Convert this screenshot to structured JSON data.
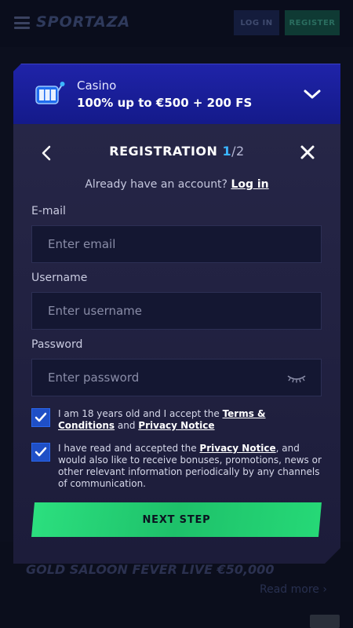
{
  "header": {
    "logo_text": "SPORTAZA",
    "login_label": "LOG IN",
    "register_label": "REGISTER"
  },
  "background": {
    "feature_title": "GOLD SALOON FEVER LIVE €50,000",
    "read_more": "Read more ›"
  },
  "promo": {
    "category": "Casino",
    "offer": "100% up to €500 + 200 FS",
    "icon": "slot-machine-icon"
  },
  "registration": {
    "title": "REGISTRATION",
    "step_current": "1",
    "step_total": "/2",
    "have_account_text": "Already have an account?",
    "login_link": "Log in",
    "email_label": "E-mail",
    "email_placeholder": "Enter email",
    "username_label": "Username",
    "username_placeholder": "Enter username",
    "password_label": "Password",
    "password_placeholder": "Enter password",
    "consent1_pre": "I am 18 years old and I accept the ",
    "consent1_terms": "Terms & Conditions",
    "consent1_and": " and ",
    "consent1_privacy": "Privacy Notice",
    "consent2_pre": "I have read and accepted the ",
    "consent2_privacy": "Privacy Notice",
    "consent2_post": ", and would also like to receive bonuses, promotions, news or other relevant information periodically by any channels of communication.",
    "next_button": "NEXT STEP"
  },
  "colors": {
    "accent_blue": "#3bb6ff",
    "cta_green": "#2ce07f",
    "promo_blue": "#1f23a8",
    "checkbox_blue": "#1f4fc6"
  }
}
